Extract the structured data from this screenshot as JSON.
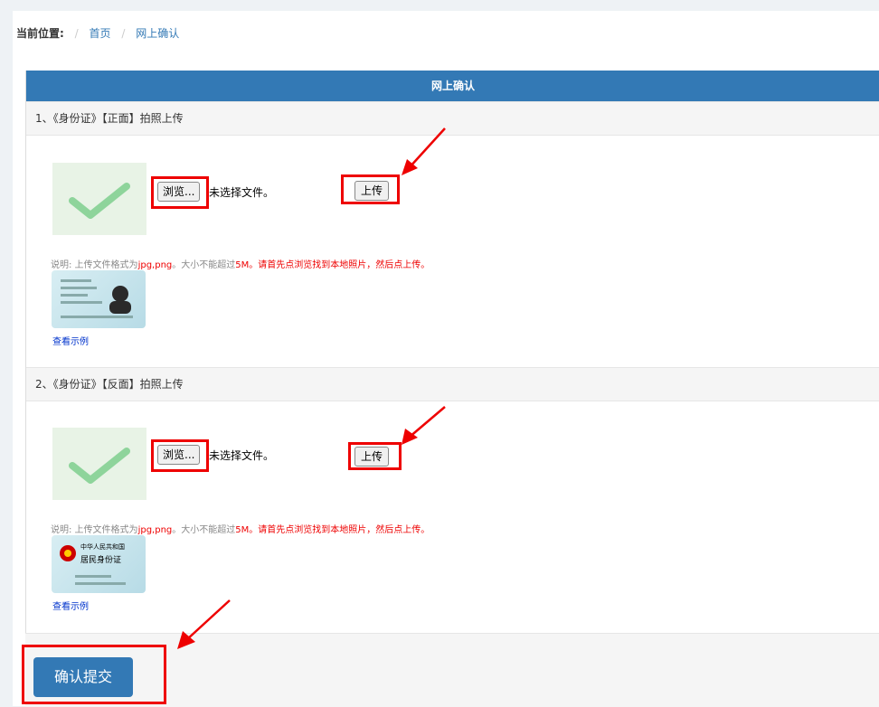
{
  "breadcrumb": {
    "label": "当前位置:",
    "items": [
      "首页",
      "网上确认"
    ]
  },
  "table": {
    "header": "网上确认"
  },
  "sections": [
    {
      "title": "1、《身份证》【正面】拍照上传",
      "browse_label": "浏览...",
      "file_status": "未选择文件。",
      "upload_label": "上传",
      "note_prefix": "说明: 上传文件格式为",
      "note_format": "jpg,png",
      "note_mid": "。大小不能超过",
      "note_size": "5M",
      "note_suffix": "。请首先点浏览找到本地照片，然后点上传。",
      "example_link": "查看示例"
    },
    {
      "title": "2、《身份证》【反面】拍照上传",
      "browse_label": "浏览...",
      "file_status": "未选择文件。",
      "upload_label": "上传",
      "note_prefix": "说明: 上传文件格式为",
      "note_format": "jpg,png",
      "note_mid": "。大小不能超过",
      "note_size": "5M",
      "note_suffix": "。请首先点浏览找到本地照片，然后点上传。",
      "example_link": "查看示例",
      "card_back_line1": "中华人民共和国",
      "card_back_line2": "居民身份证"
    }
  ],
  "submit_label": "确认提交",
  "colors": {
    "primary": "#3379b5",
    "annotation": "#e00000"
  }
}
